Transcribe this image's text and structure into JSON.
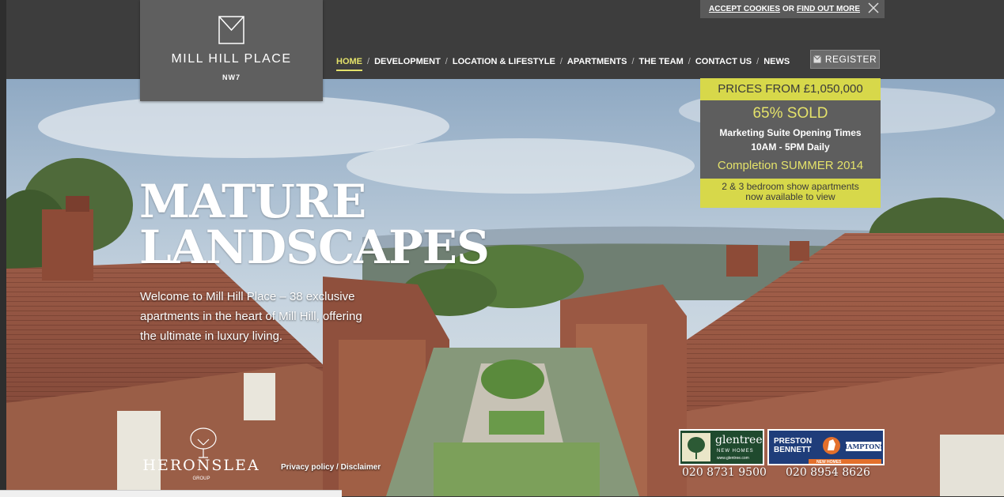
{
  "header": {
    "logo": {
      "name": "MILL HILL PLACE",
      "sub": "NW7",
      "icon": "m-monogram-icon"
    },
    "nav": [
      {
        "label": "HOME",
        "active": true
      },
      {
        "label": "DEVELOPMENT"
      },
      {
        "label": "LOCATION & LIFESTYLE"
      },
      {
        "label": "APARTMENTS"
      },
      {
        "label": "THE TEAM"
      },
      {
        "label": "CONTACT US"
      },
      {
        "label": "NEWS"
      }
    ],
    "nav_separator": "/",
    "register_label": "REGISTER",
    "cookie": {
      "accept": "ACCEPT COOKIES",
      "or": "OR",
      "find": "FIND OUT MORE",
      "close_icon": "close-icon"
    }
  },
  "promo": {
    "prices": "PRICES FROM £1,050,000",
    "sold": "65% SOLD",
    "suite": "Marketing Suite Opening Times",
    "times": "10AM - 5PM Daily",
    "completion": "Completion SUMMER 2014",
    "show_line1": "2 & 3 bedroom show apartments",
    "show_line2": "now available to view"
  },
  "hero": {
    "headline_line1": "MATURE",
    "headline_line2": "LANDSCAPES",
    "intro": "Welcome to Mill Hill Place – 38 exclusive apartments in the heart of Mill Hill, offering the ultimate in luxury living."
  },
  "footer": {
    "developer": {
      "name": "HERONSLEA",
      "group": "GROUP"
    },
    "privacy": "Privacy policy",
    "slash": " / ",
    "disclaimer": "Disclaimer",
    "agent1": {
      "name": "glentree",
      "sub": "NEW HOMES",
      "url": "www.glentree.com",
      "phone": "020 8731 9500"
    },
    "agent2": {
      "name_line1": "PRESTON",
      "name_line2": "BENNETT",
      "partner": "HAMPTONS",
      "sub": "NEW HOMES",
      "phone": "020 8954 8626"
    }
  },
  "colors": {
    "accent": "#d7d84a",
    "accent_text": "#e4e26a",
    "panel": "#5e5e5e",
    "topbar": "#3d3d3d"
  }
}
